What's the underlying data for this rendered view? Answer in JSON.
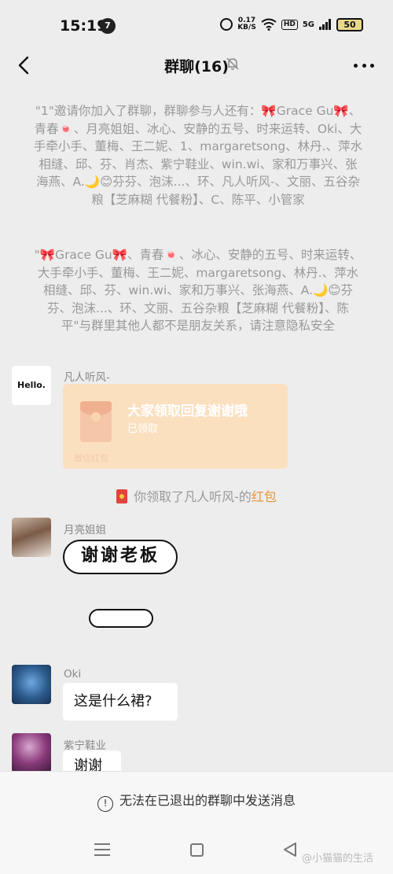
{
  "status_bar": {
    "time": "15:19",
    "notification_count": "7",
    "net_speed_top": "0.17",
    "net_speed_bottom": "KB/S",
    "hd": "HD",
    "signal": "5G",
    "battery": "50"
  },
  "nav": {
    "title": "群聊(16)"
  },
  "notices": {
    "invite": "\"1\"邀请你加入了群聊，群聊参与人还有：🎀Grace Gu🎀、青春🍬、月亮姐姐、冰心、安静的五号、时来运转、Oki、大手牵小手、董梅、王二妮、1、margaretsong、林丹.、萍水相缝、邱、芬、肖杰、紫宁鞋业、win.wi、家和万事兴、张海燕、A.🌙😊芬芬、泡沫...、环、凡人听风-、文丽、五谷杂粮【芝麻糊 代餐粉】、C、陈平、小管家",
    "privacy": "\"🎀Grace Gu🎀、青春🍬、冰心、安静的五号、时来运转、大手牵小手、董梅、王二妮、margaretsong、林丹.、萍水相缝、邱、芬、win.wi、家和万事兴、张海燕、A.🌙😊芬芬、泡沫...、环、文丽、五谷杂粮【芝麻糊 代餐粉】、陈平\"与群里其他人都不是朋友关系，请注意隐私安全"
  },
  "messages": {
    "m1": {
      "avatar_text": "Hello.",
      "sender": "凡人听风-",
      "packet_title": "大家领取回复谢谢哦",
      "packet_status": "已领取",
      "packet_label": "微信红包"
    },
    "packet_notice": {
      "prefix": "你领取了凡人听风-的",
      "link": "红包"
    },
    "m2": {
      "sender": "月亮姐姐",
      "sticker_text": "谢谢老板"
    },
    "m3": {
      "sender": "Oki",
      "text": "这是什么裙?"
    },
    "m4": {
      "sender": "紫宁鞋业",
      "text": "谢谢"
    }
  },
  "bottom": {
    "info_icon": "!",
    "message": "无法在已退出的群聊中发送消息"
  },
  "watermark": "@小猫猫的生活"
}
